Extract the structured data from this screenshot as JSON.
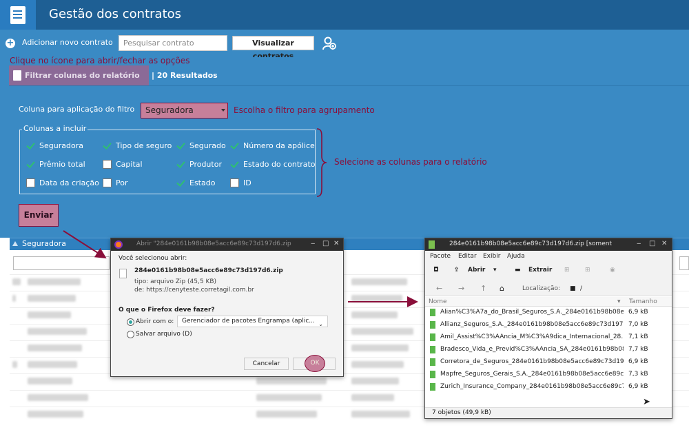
{
  "header": {
    "title": "Gestão dos contratos"
  },
  "toolbar": {
    "add_label": "Adicionar novo contrato",
    "search_placeholder": "Pesquisar contrato",
    "view_label": "Visualizar contratos"
  },
  "annotations": {
    "toggle_hint": "Clique no ícone para abrir/fechar as opções",
    "filter_hint": "Escolha o filtro para agrupamento",
    "columns_hint": "Selecione as colunas para o relatório"
  },
  "tabs": {
    "filter_label": "Filtrar colunas do relatório",
    "results_label": "| 20 Resultados"
  },
  "filter": {
    "label": "Coluna para aplicação do filtro",
    "selected": "Seguradora"
  },
  "columns": {
    "legend": "Colunas a incluir",
    "items": [
      {
        "label": "Seguradora",
        "checked": true
      },
      {
        "label": "Tipo de seguro",
        "checked": true
      },
      {
        "label": "Segurado",
        "checked": true
      },
      {
        "label": "Número da apólice",
        "checked": true
      },
      {
        "label": "Prêmio total",
        "checked": true
      },
      {
        "label": "Capital",
        "checked": false
      },
      {
        "label": "Produtor",
        "checked": true
      },
      {
        "label": "Estado do contrato",
        "checked": true
      },
      {
        "label": "Data da criação",
        "checked": false
      },
      {
        "label": "Por",
        "checked": false
      },
      {
        "label": "Estado",
        "checked": true
      },
      {
        "label": "ID",
        "checked": false
      }
    ]
  },
  "send_label": "Enviar",
  "table": {
    "header": "Seguradora"
  },
  "firefox_dialog": {
    "title": "Abrir \"284e0161b98b08e5acc6e89c73d197d6.zip",
    "intro": "Você selecionou abrir:",
    "filename": "284e0161b98b08e5acc6e89c73d197d6.zip",
    "type_line": "tipo: arquivo Zip (45,5 KB)",
    "from_line": "de: https://cenyteste.corretagil.com.br",
    "question": "O que o Firefox deve fazer?",
    "open_with": "Abrir com o:",
    "app": "Gerenciador de pacotes Engrampa (aplic...",
    "save_file": "Salvar arquivo (D)",
    "cancel": "Cancelar",
    "ok": "OK"
  },
  "engrampa": {
    "title": "284e0161b98b08e5acc6e89c73d197d6.zip [soment",
    "menu": [
      "Pacote",
      "Editar",
      "Exibir",
      "Ajuda"
    ],
    "open": "Abrir",
    "extract": "Extrair",
    "location_label": "Localização:",
    "location": "/",
    "col_name": "Nome",
    "col_size": "Tamanho",
    "files": [
      {
        "name": "Alian%C3%A7a_do_Brasil_Seguros_S.A._284e0161b98b08e…",
        "size": "6,9 kB"
      },
      {
        "name": "Allianz_Seguros_S.A._284e0161b98b08e5acc6e89c73d197d6…",
        "size": "7,0 kB"
      },
      {
        "name": "Amil_Assist%C3%AAncia_M%C3%A9dica_Internacional_28…",
        "size": "7,1 kB"
      },
      {
        "name": "Bradesco_Vida_e_Previd%C3%AAncia_SA_284e0161b98b08…",
        "size": "7,7 kB"
      },
      {
        "name": "Corretora_de_Seguros_284e0161b98b08e5acc6e89c73d197d6…",
        "size": "6,9 kB"
      },
      {
        "name": "Mapfre_Seguros_Gerais_S.A._284e0161b98b08e5acc6e89c7…",
        "size": "7,3 kB"
      },
      {
        "name": "Zurich_Insurance_Company_284e0161b98b08e5acc6e89c73…",
        "size": "6,9 kB"
      }
    ],
    "status": "7 objetos (49,9 kB)"
  },
  "colors": {
    "header": "#1e5f94",
    "panel": "#3a8ac4",
    "annotation": "#8a0f3a",
    "highlight": "#c77f9a",
    "check": "#2fbf71"
  }
}
